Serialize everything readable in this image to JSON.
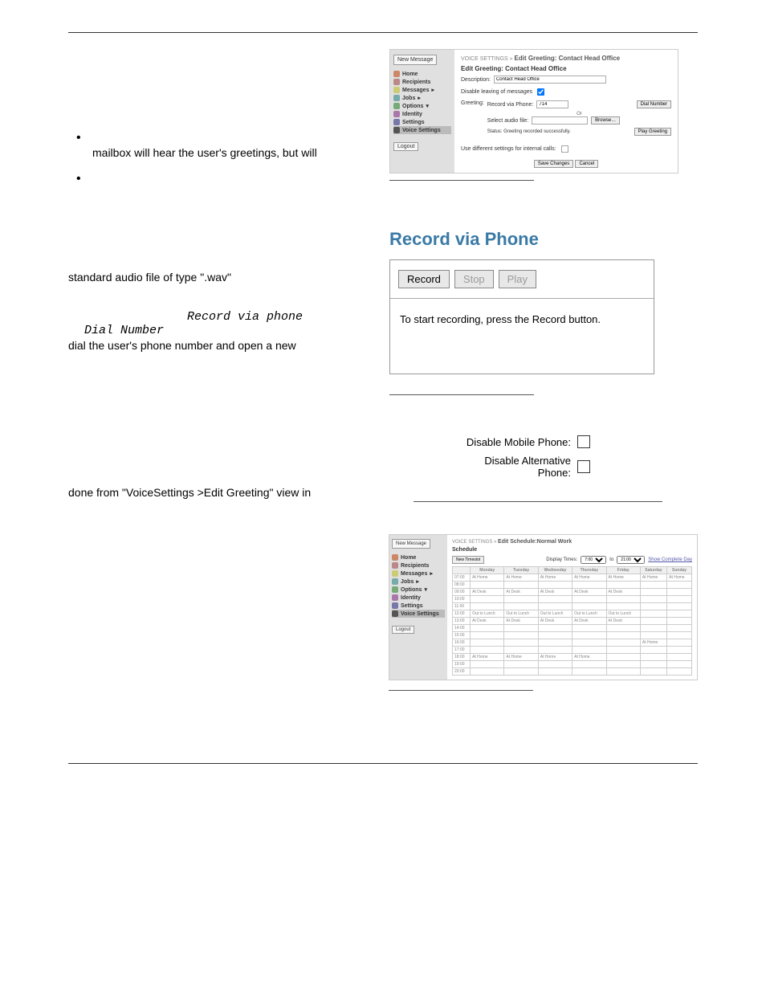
{
  "bullets": [
    "mailbox will hear the user's greetings, but will",
    ""
  ],
  "text": {
    "wav_line": "standard audio file of type \".wav\"",
    "record_via_phone": "Record via phone",
    "dial_number": "Dial Number",
    "dial_line": "dial the user's phone number and open a new",
    "done_from": "done from \"VoiceSettings >Edit Greeting\" view in"
  },
  "fig1": {
    "new_message": "New Message",
    "nav": [
      "Home",
      "Recipients",
      "Messages",
      "Jobs",
      "Options",
      "Identity",
      "Settings",
      "Voice Settings"
    ],
    "logout": "Logout",
    "breadcrumb_prefix": "VOICE SETTINGS »",
    "breadcrumb_title": "Edit Greeting: Contact Head Office",
    "form_title": "Edit Greeting: Contact Head Office",
    "desc_label": "Description:",
    "desc_value": "Contact Head Office",
    "disable_leave": "Disable leaving of messages",
    "greeting_label": "Greeting:",
    "record_via": "Record via Phone:",
    "record_num": "714",
    "dial_btn": "Dial Number",
    "or": "Or",
    "select_file": "Select audio file:",
    "browse": "Browse…",
    "status_label": "Status:",
    "status_text": "Greeting recorded successfully.",
    "play_btn": "Play Greeting",
    "internal": "Use different settings for internal calls:",
    "save": "Save Changes",
    "cancel": "Cancel"
  },
  "rvp": {
    "heading": "Record via Phone",
    "record": "Record",
    "stop": "Stop",
    "play": "Play",
    "instruction": "To start recording, press the Record button."
  },
  "disable": {
    "mobile": "Disable Mobile Phone:",
    "alt": "Disable Alternative Phone:"
  },
  "sched": {
    "new_message": "New Message",
    "nav": [
      "Home",
      "Recipients",
      "Messages",
      "Jobs",
      "Options",
      "Identity",
      "Settings",
      "Voice Settings"
    ],
    "logout": "Logout",
    "breadcrumb_prefix": "VOICE SETTINGS »",
    "breadcrumb_title": "Edit Schedule:Normal Work",
    "section": "Schedule",
    "new_timeslot": "New Timeslot",
    "display_times": "Display Times:",
    "time_from": "7:00",
    "time_to": "21:00",
    "show_complete": "Show Complete Day",
    "to_sep": "to",
    "days": [
      "",
      "Monday",
      "Tuesday",
      "Wednesday",
      "Thursday",
      "Friday",
      "Saturday",
      "Sunday"
    ],
    "rows": [
      {
        "h": "07:00",
        "c": [
          "At Home",
          "At Home",
          "At Home",
          "At Home",
          "At Home",
          "At Home",
          "At Home"
        ]
      },
      {
        "h": "08:00",
        "c": [
          "",
          "",
          "",
          "",
          "",
          "",
          ""
        ]
      },
      {
        "h": "09:00",
        "c": [
          "At Desk",
          "At Desk",
          "At Desk",
          "At Desk",
          "At Desk",
          "",
          ""
        ]
      },
      {
        "h": "10:00",
        "c": [
          "",
          "",
          "",
          "",
          "",
          "",
          ""
        ]
      },
      {
        "h": "11:00",
        "c": [
          "",
          "",
          "",
          "",
          "",
          "",
          ""
        ]
      },
      {
        "h": "12:00",
        "c": [
          "Out to Lunch",
          "Out to Lunch",
          "Out to Lunch",
          "Out to Lunch",
          "Out to Lunch",
          "",
          ""
        ]
      },
      {
        "h": "13:00",
        "c": [
          "At Desk",
          "At Desk",
          "At Desk",
          "At Desk",
          "At Desk",
          "",
          ""
        ]
      },
      {
        "h": "14:00",
        "c": [
          "",
          "",
          "",
          "",
          "",
          "",
          ""
        ]
      },
      {
        "h": "15:00",
        "c": [
          "",
          "",
          "",
          "",
          "",
          "",
          ""
        ]
      },
      {
        "h": "16:00",
        "c": [
          "",
          "",
          "",
          "",
          "",
          "At Home",
          ""
        ]
      },
      {
        "h": "17:00",
        "c": [
          "",
          "",
          "",
          "",
          "",
          "",
          ""
        ]
      },
      {
        "h": "18:00",
        "c": [
          "At Home",
          "At Home",
          "At Home",
          "At Home",
          "",
          "",
          ""
        ]
      },
      {
        "h": "19:00",
        "c": [
          "",
          "",
          "",
          "",
          "",
          "",
          ""
        ]
      },
      {
        "h": "20:00",
        "c": [
          "",
          "",
          "",
          "",
          "",
          "",
          ""
        ]
      }
    ]
  }
}
